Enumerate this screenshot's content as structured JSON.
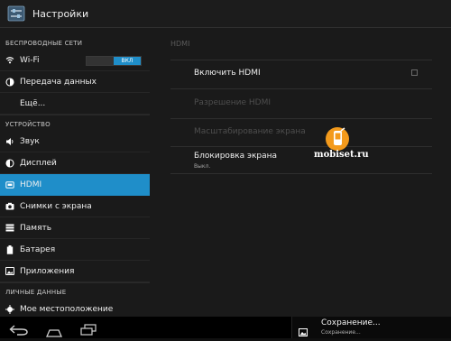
{
  "app": {
    "title": "Настройки"
  },
  "sidebar": {
    "headers": [
      "БЕСПРОВОДНЫЕ СЕТИ",
      "УСТРОЙСТВО",
      "ЛИЧНЫЕ ДАННЫЕ"
    ],
    "items": [
      {
        "label": "Wi-Fi",
        "icon": "wifi-icon"
      },
      {
        "label": "Передача данных",
        "icon": "data-usage-icon"
      },
      {
        "label": "Ещё..."
      },
      {
        "label": "Звук",
        "icon": "speaker-icon"
      },
      {
        "label": "Дисплей",
        "icon": "display-icon"
      },
      {
        "label": "HDMI",
        "icon": "hdmi-icon",
        "selected": true
      },
      {
        "label": "Снимки с экрана",
        "icon": "camera-icon"
      },
      {
        "label": "Память",
        "icon": "storage-icon"
      },
      {
        "label": "Батарея",
        "icon": "battery-icon"
      },
      {
        "label": "Приложения",
        "icon": "apps-icon"
      },
      {
        "label": "Мое местоположение",
        "icon": "location-icon"
      }
    ],
    "wifi_toggle": {
      "on_label": "ВКЛ",
      "state": "on"
    }
  },
  "content": {
    "section_title": "HDMI",
    "prefs": [
      {
        "title": "Включить HDMI",
        "enabled": true,
        "checked": false
      },
      {
        "title": "Разрешение HDMI",
        "enabled": false
      },
      {
        "title": "Масштабирование экрана",
        "enabled": false
      },
      {
        "title": "Блокировка экрана",
        "summary": "Выкл.",
        "enabled": true
      }
    ]
  },
  "watermark": {
    "text": "mobiset.ru"
  },
  "notification": {
    "title": "Сохранение...",
    "subtitle": "Сохранение..."
  },
  "colors": {
    "accent": "#1f8ec9",
    "watermark_orange": "#f39a1c"
  }
}
